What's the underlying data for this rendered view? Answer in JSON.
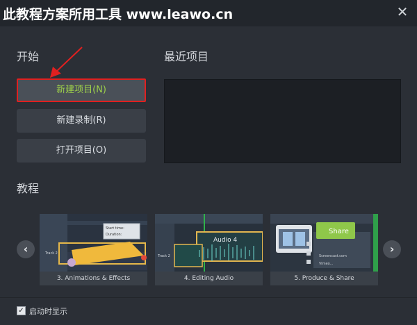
{
  "window": {
    "title": "此教程方案所用工具 www.leawo.cn",
    "close_icon": "close-icon"
  },
  "start": {
    "heading": "开始",
    "buttons": [
      {
        "label": "新建项目(N)",
        "highlighted": true
      },
      {
        "label": "新建录制(R)"
      },
      {
        "label": "打开项目(O)"
      }
    ]
  },
  "recent": {
    "heading": "最近项目"
  },
  "tutorials": {
    "heading": "教程",
    "items": [
      {
        "caption": "3. Animations & Effects",
        "overlay": [
          "Start time:",
          "Duration:",
          "Track 2"
        ]
      },
      {
        "caption": "4. Editing Audio",
        "overlay": [
          "Audio 4",
          "Track 2"
        ]
      },
      {
        "caption": "5. Produce & Share",
        "overlay": [
          "Share",
          "Screencast.com",
          "Vimeo..."
        ]
      }
    ],
    "prev_icon": "chevron-left-icon",
    "next_icon": "chevron-right-icon"
  },
  "footer": {
    "show_on_startup_label": "启动时显示",
    "checked": true
  },
  "colors": {
    "highlight_border": "#e02020",
    "primary_text": "#9fd24a",
    "arrow": "#e02020"
  }
}
